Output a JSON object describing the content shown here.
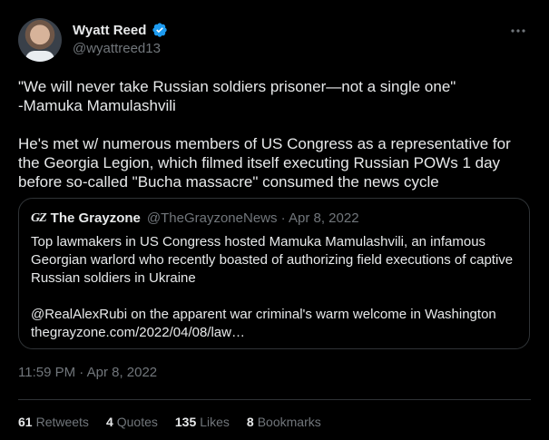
{
  "author": {
    "display_name": "Wyatt Reed",
    "handle": "@wyattreed13"
  },
  "tweet": {
    "text": "\"We will never take Russian soldiers prisoner—not a single one\"\n-Mamuka Mamulashvili\n\nHe's met w/ numerous members of US Congress as a representative for the Georgia Legion, which filmed itself executing Russian POWs 1 day before so-called \"Bucha massacre\" consumed the news cycle",
    "timestamp": "11:59 PM · Apr 8, 2022"
  },
  "quote": {
    "logo": "GZ",
    "name": "The Grayzone",
    "meta": "@TheGrayzoneNews · Apr 8, 2022",
    "text": "Top lawmakers in US Congress hosted Mamuka Mamulashvili, an infamous Georgian warlord who recently boasted of authorizing field executions of captive Russian soldiers in Ukraine\n\n@RealAlexRubi on the apparent war criminal's warm welcome in Washington\nthegrayzone.com/2022/04/08/law…"
  },
  "stats": [
    {
      "count": "61",
      "label": "Retweets"
    },
    {
      "count": "4",
      "label": "Quotes"
    },
    {
      "count": "135",
      "label": "Likes"
    },
    {
      "count": "8",
      "label": "Bookmarks"
    }
  ],
  "icons": {
    "verified": "verified-badge-icon",
    "more": "more-options-icon"
  },
  "colors": {
    "background": "#000000",
    "text": "#e7e9ea",
    "muted": "#71767b",
    "verified": "#1d9bf0",
    "border": "#2f3336"
  }
}
